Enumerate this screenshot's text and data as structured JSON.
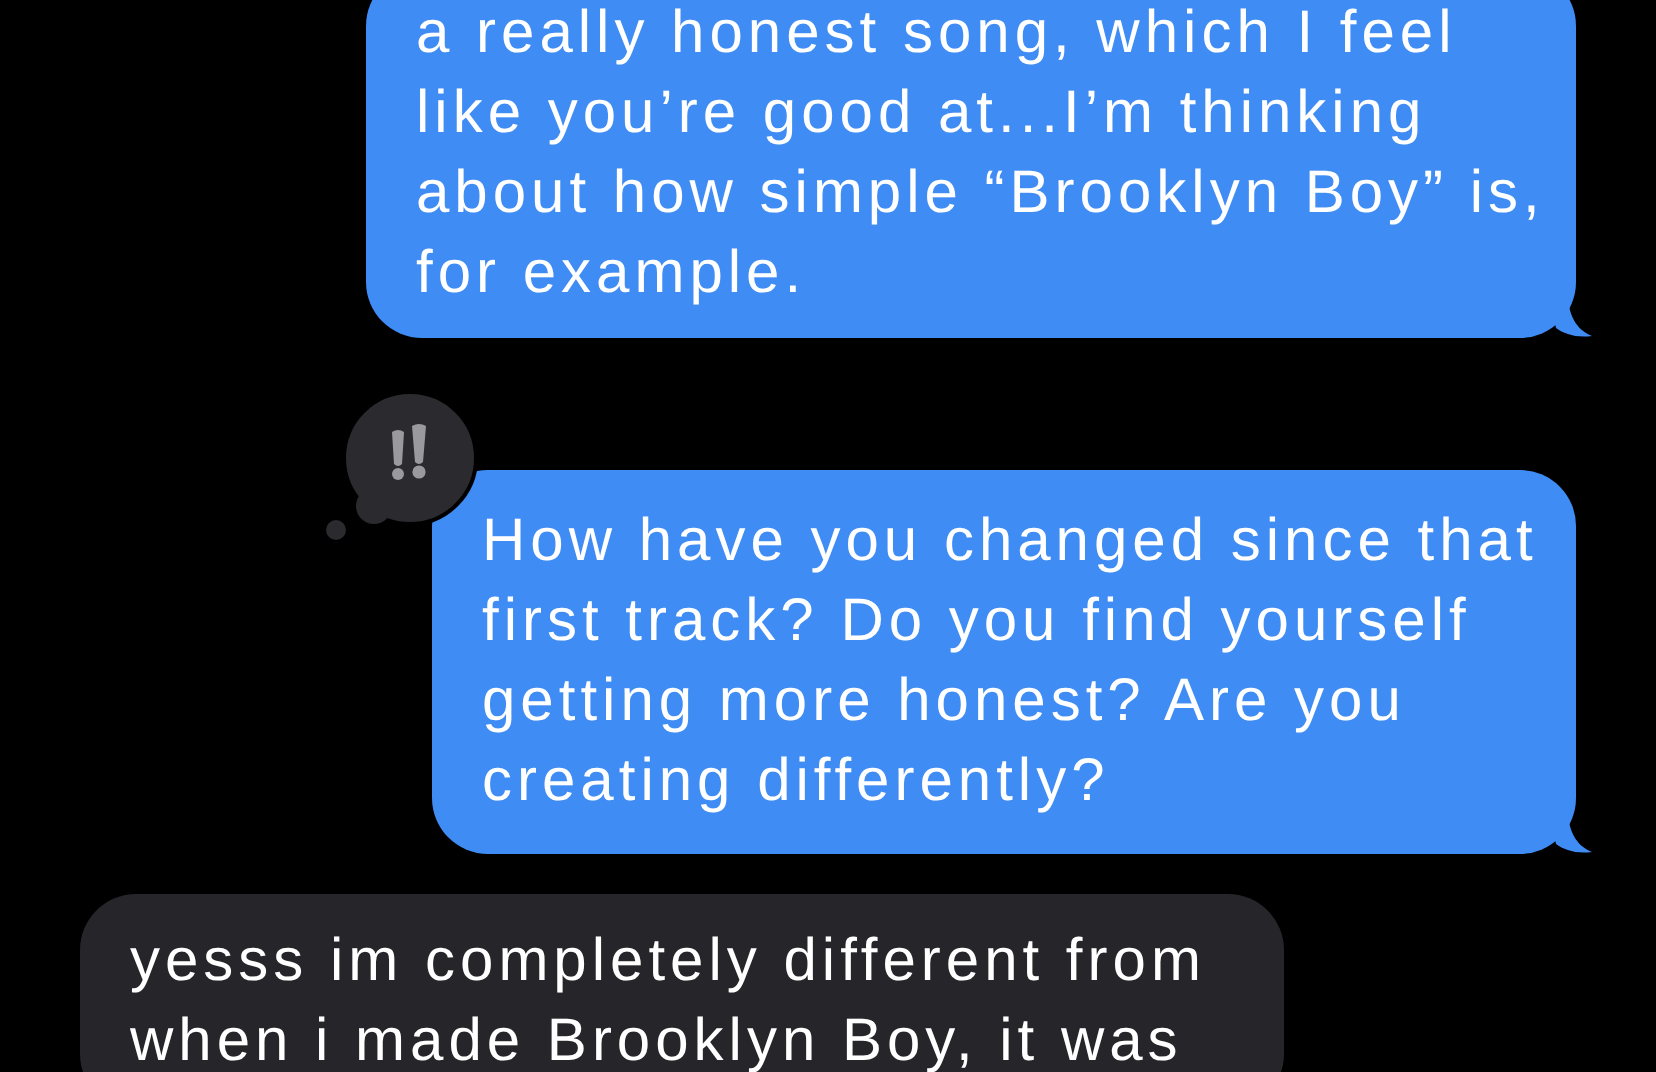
{
  "messages": [
    {
      "kind": "sent",
      "text": "a really honest song, which I feel like you’re good at...I’m thinking about how simple “Brooklyn Boy” is, for example."
    },
    {
      "kind": "sent",
      "reaction": {
        "kind": "emphasis"
      },
      "text": "How have you changed since that first track? Do you find yourself getting more honest? Are you creating differently?"
    },
    {
      "kind": "received",
      "text": "yesss im completely different from when i made Brooklyn Boy, it was"
    }
  ]
}
